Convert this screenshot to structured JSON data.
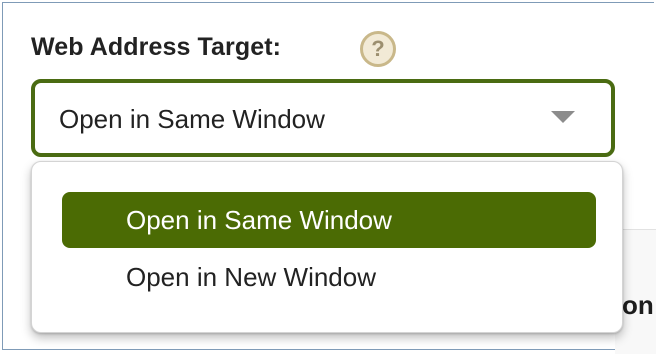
{
  "form": {
    "label": "Web Address Target:",
    "help_icon": "?",
    "selected_value": "Open in Same Window"
  },
  "dropdown": {
    "options": [
      {
        "label": "Open in Same Window",
        "selected": true
      },
      {
        "label": "Open in New Window",
        "selected": false
      }
    ]
  },
  "background": {
    "partial_text": "on"
  },
  "colors": {
    "accent": "#4b6b04",
    "border": "#4a6b12",
    "frame": "#7f9bb7"
  }
}
